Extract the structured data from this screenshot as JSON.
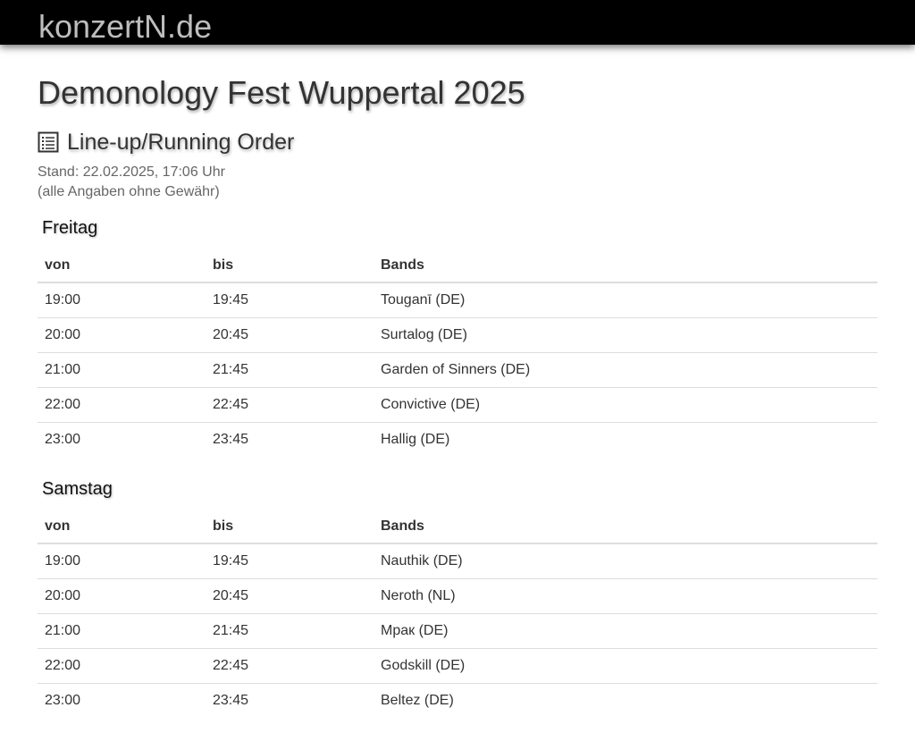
{
  "site": {
    "brand": "konzertN.de"
  },
  "page": {
    "title": "Demonology Fest Wuppertal 2025",
    "section_title": "Line-up/Running Order",
    "section_icon": "list-document-icon",
    "stand": "Stand: 22.02.2025, 17:06 Uhr",
    "disclaimer": "(alle Angaben ohne Gewähr)"
  },
  "columns": {
    "von": "von",
    "bis": "bis",
    "bands": "Bands"
  },
  "days": [
    {
      "name": "Freitag",
      "rows": [
        {
          "von": "19:00",
          "bis": "19:45",
          "band": "Touganī (DE)"
        },
        {
          "von": "20:00",
          "bis": "20:45",
          "band": "Surtalog (DE)"
        },
        {
          "von": "21:00",
          "bis": "21:45",
          "band": "Garden of Sinners (DE)"
        },
        {
          "von": "22:00",
          "bis": "22:45",
          "band": "Convictive (DE)"
        },
        {
          "von": "23:00",
          "bis": "23:45",
          "band": "Hallig (DE)"
        }
      ]
    },
    {
      "name": "Samstag",
      "rows": [
        {
          "von": "19:00",
          "bis": "19:45",
          "band": "Nauthik (DE)"
        },
        {
          "von": "20:00",
          "bis": "20:45",
          "band": "Neroth (NL)"
        },
        {
          "von": "21:00",
          "bis": "21:45",
          "band": "Мрак (DE)"
        },
        {
          "von": "22:00",
          "bis": "22:45",
          "band": "Godskill (DE)"
        },
        {
          "von": "23:00",
          "bis": "23:45",
          "band": "Beltez (DE)"
        }
      ]
    }
  ],
  "colors": {
    "topbar": "#000000",
    "brand": "#bdbdbd",
    "text": "#333333",
    "muted": "#666666",
    "rule": "#dddddd"
  }
}
